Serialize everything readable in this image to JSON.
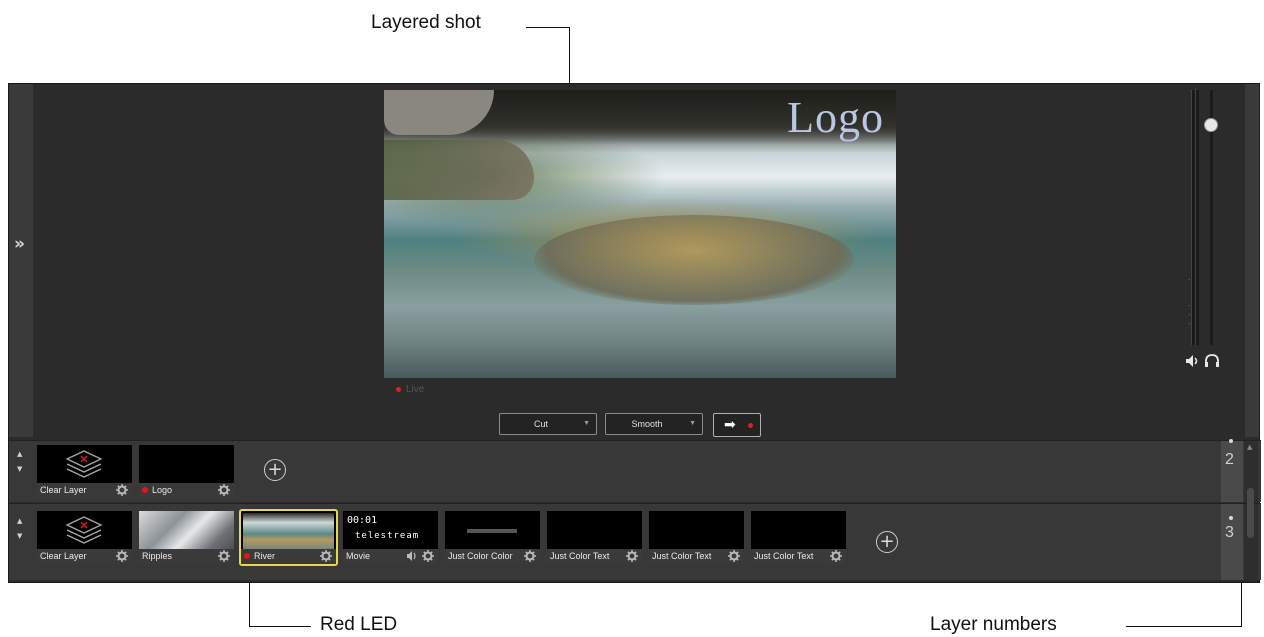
{
  "callouts": {
    "layered_shot": "Layered shot",
    "red_led": "Red LED",
    "layer_numbers": "Layer numbers"
  },
  "preview": {
    "overlay_text": "Logo",
    "live_label": "Live"
  },
  "transition": {
    "cut_label": "Cut",
    "smooth_label": "Smooth"
  },
  "meter": {
    "ticks": [
      "+6",
      "0",
      "-6",
      "-12",
      "-18",
      "-24",
      "-36"
    ]
  },
  "layers": [
    {
      "number": "2",
      "tiles": [
        {
          "label": "Clear Layer",
          "icon": "clear-layer-icon"
        },
        {
          "label": "Logo",
          "led": true
        }
      ]
    },
    {
      "number": "3",
      "tiles": [
        {
          "label": "Clear Layer",
          "icon": "clear-layer-icon"
        },
        {
          "label": "Ripples"
        },
        {
          "label": "River",
          "led": true,
          "selected": true
        },
        {
          "label": "Movie",
          "timecode": "00:01",
          "brand": "telestream"
        },
        {
          "label": "Just Color Color"
        },
        {
          "label": "Just Color Text"
        },
        {
          "label": "Just Color Text"
        },
        {
          "label": "Just Color Text"
        }
      ]
    }
  ],
  "colors": {
    "led_red": "#e01818",
    "selected_border": "#e5d84a"
  }
}
